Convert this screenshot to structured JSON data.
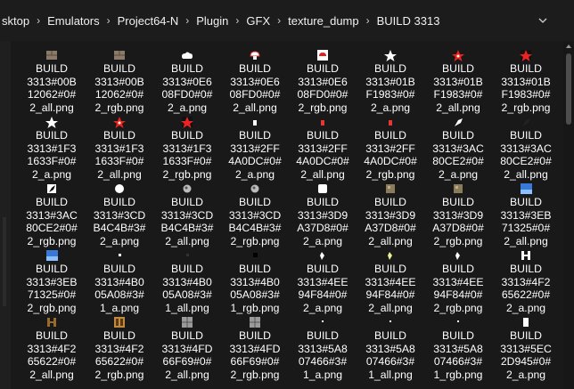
{
  "breadcrumbs": [
    "sktop",
    "Emulators",
    "Project64-N",
    "Plugin",
    "GFX",
    "texture_dump",
    "BUILD 3313"
  ],
  "files": [
    {
      "lines": [
        "BUILD",
        "3313#00B",
        "12062#0#",
        "2_all.png"
      ],
      "thumb": "brick"
    },
    {
      "lines": [
        "BUILD",
        "3313#00B",
        "12062#0#",
        "2_rgb.png"
      ],
      "thumb": "brick"
    },
    {
      "lines": [
        "BUILD",
        "3313#0E6",
        "08FD0#0#",
        "2_a.png"
      ],
      "thumb": "cloud"
    },
    {
      "lines": [
        "BUILD",
        "3313#0E6",
        "08FD0#0#",
        "2_all.png"
      ],
      "thumb": "mushroom"
    },
    {
      "lines": [
        "BUILD",
        "3313#0E6",
        "08FD0#0#",
        "2_rgb.png"
      ],
      "thumb": "mushroom-box"
    },
    {
      "lines": [
        "BUILD",
        "3313#01B",
        "F1983#0#",
        "2_a.png"
      ],
      "thumb": "star-white"
    },
    {
      "lines": [
        "BUILD",
        "3313#01B",
        "F1983#0#",
        "2_all.png"
      ],
      "thumb": "star-red"
    },
    {
      "lines": [
        "BUILD",
        "3313#01B",
        "F1983#0#",
        "2_rgb.png"
      ],
      "thumb": "star-red-box"
    },
    {
      "lines": [
        "BUILD",
        "3313#1F3",
        "1633F#0#",
        "2_a.png"
      ],
      "thumb": "star-white"
    },
    {
      "lines": [
        "BUILD",
        "3313#1F3",
        "1633F#0#",
        "2_all.png"
      ],
      "thumb": "star-red"
    },
    {
      "lines": [
        "BUILD",
        "3313#1F3",
        "1633F#0#",
        "2_rgb.png"
      ],
      "thumb": "star-red-box"
    },
    {
      "lines": [
        "BUILD",
        "3313#2FF",
        "4A0DC#0#",
        "2_a.png"
      ],
      "thumb": "tiny-white"
    },
    {
      "lines": [
        "BUILD",
        "3313#2FF",
        "4A0DC#0#",
        "2_all.png"
      ],
      "thumb": "tiny-red"
    },
    {
      "lines": [
        "BUILD",
        "3313#2FF",
        "4A0DC#0#",
        "2_rgb.png"
      ],
      "thumb": "tiny-red"
    },
    {
      "lines": [
        "BUILD",
        "3313#3AC",
        "80CE2#0#",
        "2_a.png"
      ],
      "thumb": "shard"
    },
    {
      "lines": [
        "BUILD",
        "3313#3AC",
        "80CE2#0#",
        "2_all.png"
      ],
      "thumb": "shard-dark"
    },
    {
      "lines": [
        "BUILD",
        "3313#3AC",
        "80CE2#0#",
        "2_rgb.png"
      ],
      "thumb": "shard-box"
    },
    {
      "lines": [
        "BUILD",
        "3313#3CD",
        "B4C4B#3#",
        "2_a.png"
      ],
      "thumb": "blob"
    },
    {
      "lines": [
        "BUILD",
        "3313#3CD",
        "B4C4B#3#",
        "2_all.png"
      ],
      "thumb": "blob-gray"
    },
    {
      "lines": [
        "BUILD",
        "3313#3CD",
        "B4C4B#3#",
        "2_rgb.png"
      ],
      "thumb": "blob-gray"
    },
    {
      "lines": [
        "BUILD",
        "3313#3D9",
        "A37D8#0#",
        "2_a.png"
      ],
      "thumb": "white-block"
    },
    {
      "lines": [
        "BUILD",
        "3313#3D9",
        "A37D8#0#",
        "2_all.png"
      ],
      "thumb": "stone"
    },
    {
      "lines": [
        "BUILD",
        "3313#3D9",
        "A37D8#0#",
        "2_rgb.png"
      ],
      "thumb": "stone"
    },
    {
      "lines": [
        "BUILD",
        "3313#3EB",
        "71325#0#",
        "2_all.png"
      ],
      "thumb": "sky"
    },
    {
      "lines": [
        "BUILD",
        "3313#3EB",
        "71325#0#",
        "2_rgb.png"
      ],
      "thumb": "sky"
    },
    {
      "lines": [
        "BUILD",
        "3313#4B0",
        "05A08#3#",
        "1_a.png"
      ],
      "thumb": "dot-white"
    },
    {
      "lines": [
        "BUILD",
        "3313#4B0",
        "05A08#3#",
        "1_all.png"
      ],
      "thumb": "dot-dark"
    },
    {
      "lines": [
        "BUILD",
        "3313#4B0",
        "05A08#3#",
        "1_rgb.png"
      ],
      "thumb": "dot-black"
    },
    {
      "lines": [
        "BUILD",
        "3313#4EE",
        "94F84#0#",
        "2_a.png"
      ],
      "thumb": "spark"
    },
    {
      "lines": [
        "BUILD",
        "3313#4EE",
        "94F84#0#",
        "2_all.png"
      ],
      "thumb": "spark-yellow"
    },
    {
      "lines": [
        "BUILD",
        "3313#4EE",
        "94F84#0#",
        "2_rgb.png"
      ],
      "thumb": "spark"
    },
    {
      "lines": [
        "BUILD",
        "3313#4F2",
        "65622#0#",
        "2_a.png"
      ],
      "thumb": "h-white"
    },
    {
      "lines": [
        "BUILD",
        "3313#4F2",
        "65622#0#",
        "2_all.png"
      ],
      "thumb": "h-brown"
    },
    {
      "lines": [
        "BUILD",
        "3313#4F2",
        "65622#0#",
        "2_rgb.png"
      ],
      "thumb": "h-brown-box"
    },
    {
      "lines": [
        "BUILD",
        "3313#4FD",
        "66F69#0#",
        "2_all.png"
      ],
      "thumb": "window-gray"
    },
    {
      "lines": [
        "BUILD",
        "3313#4FD",
        "66F69#0#",
        "2_rgb.png"
      ],
      "thumb": "window-gray"
    },
    {
      "lines": [
        "BUILD",
        "3313#5A8",
        "07466#3#",
        "1_a.png"
      ],
      "thumb": "speck"
    },
    {
      "lines": [
        "BUILD",
        "3313#5A8",
        "07466#3#",
        "1_all.png"
      ],
      "thumb": "speck"
    },
    {
      "lines": [
        "BUILD",
        "3313#5A8",
        "07466#3#",
        "1_rgb.png"
      ],
      "thumb": "speck"
    },
    {
      "lines": [
        "BUILD",
        "3313#5EC",
        "2D945#0#",
        "2_a.png"
      ],
      "thumb": "corner-white"
    }
  ]
}
